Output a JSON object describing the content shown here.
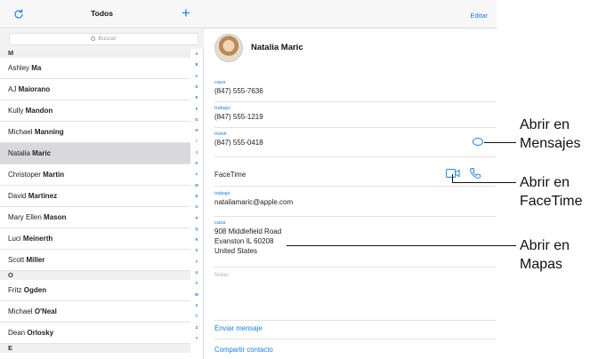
{
  "left": {
    "title": "Todos",
    "search_placeholder": "Buscar",
    "refresh_icon": "refresh-icon",
    "add_icon": "plus-icon"
  },
  "sections": [
    {
      "letter": "M"
    },
    {
      "letter": "O"
    },
    {
      "letter": "E"
    }
  ],
  "contacts": [
    {
      "first": "Ashley",
      "last": "Ma"
    },
    {
      "first": "AJ",
      "last": "Maiorano"
    },
    {
      "first": "Kully",
      "last": "Mandon"
    },
    {
      "first": "Michael",
      "last": "Manning"
    },
    {
      "first": "Natalia",
      "last": "Maric"
    },
    {
      "first": "Christoper",
      "last": "Martin"
    },
    {
      "first": "David",
      "last": "Martinez"
    },
    {
      "first": "Mary Ellen",
      "last": "Mason"
    },
    {
      "first": "Luci",
      "last": "Meinerth"
    },
    {
      "first": "Scott",
      "last": "Miller"
    },
    {
      "first": "Fritz",
      "last": "Ogden"
    },
    {
      "first": "Michael",
      "last": "O'Neal"
    },
    {
      "first": "Dean",
      "last": "Orlosky"
    }
  ],
  "index_letters": [
    "A",
    "B",
    "C",
    "D",
    "E",
    "F",
    "G",
    "H",
    "I",
    "J",
    "K",
    "L",
    "M",
    "N",
    "O",
    "P",
    "Q",
    "R",
    "S",
    "T",
    "U",
    "V",
    "W",
    "X",
    "Y",
    "Z",
    "#"
  ],
  "detail": {
    "edit_label": "Editar",
    "name": "Natalia Maric",
    "phones": [
      {
        "label": "casa",
        "value": "(847) 555-7636"
      },
      {
        "label": "trabajo",
        "value": "(847) 555-1219"
      },
      {
        "label": "móvil",
        "value": "(847) 555-0418"
      }
    ],
    "facetime_label": "FaceTime",
    "email": {
      "label": "trabajo",
      "value": "nataliamaric@apple.com"
    },
    "address": {
      "label": "casa",
      "line1": "908 Middlefield Road",
      "line2": "Evanston IL 60208",
      "line3": "United States"
    },
    "notes_placeholder": "Notas",
    "send_message": "Enviar mensaje",
    "share_contact": "Compartir contacto"
  },
  "callouts": {
    "messages_line1": "Abrir en",
    "messages_line2": "Mensajes",
    "facetime_line1": "Abrir en",
    "facetime_line2": "FaceTime",
    "maps_line1": "Abrir en",
    "maps_line2": "Mapas"
  },
  "colors": {
    "accent": "#1a7fe8",
    "selected_row": "#d9d9dd"
  }
}
